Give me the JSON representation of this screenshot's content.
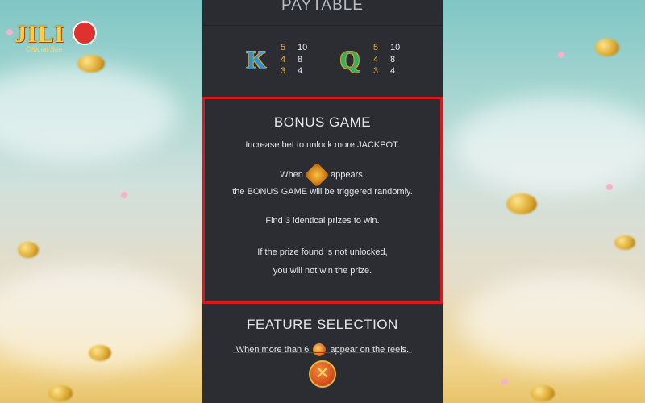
{
  "logo": {
    "text": "JILI",
    "subtext": "Official Site"
  },
  "paytable": {
    "title": "PAYTABLE",
    "symbols": [
      {
        "name": "K",
        "counts": [
          "5",
          "4",
          "3"
        ],
        "values": [
          "10",
          "8",
          "4"
        ]
      },
      {
        "name": "Q",
        "counts": [
          "5",
          "4",
          "3"
        ],
        "values": [
          "10",
          "8",
          "4"
        ]
      }
    ]
  },
  "bonus": {
    "title": "BONUS GAME",
    "line1": "Increase bet to unlock more JACKPOT.",
    "line2_pre": "When",
    "line2_post": "appears,",
    "line3": "the BONUS GAME will be triggered randomly.",
    "line4": "Find 3 identical prizes to win.",
    "line5": "If the prize found is not unlocked,",
    "line6": "you will not win the prize.",
    "highlight_color": "#e0141b"
  },
  "feature": {
    "title": "FEATURE SELECTION",
    "line_pre": "When more than 6",
    "line_post": "appear on the reels."
  },
  "close_label": "✕"
}
